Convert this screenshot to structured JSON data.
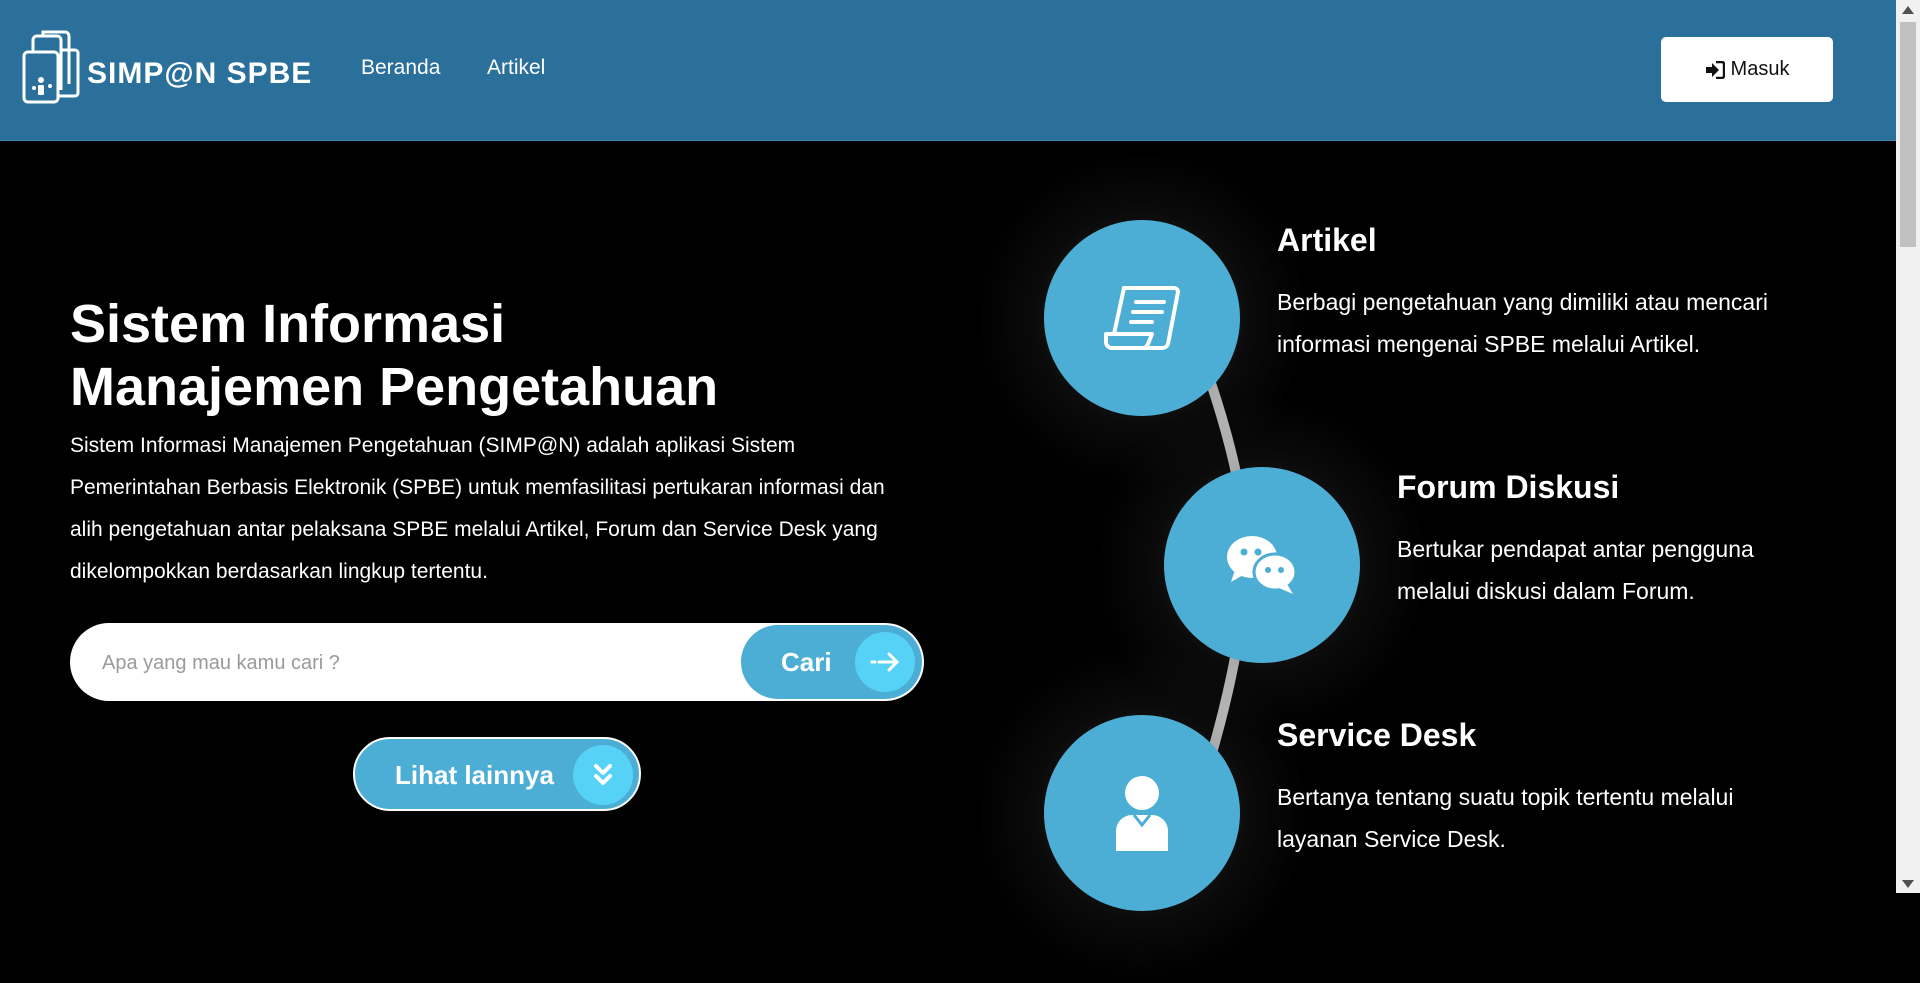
{
  "header": {
    "logo_text": "SIMP@N SPBE",
    "nav": [
      {
        "label": "Beranda"
      },
      {
        "label": "Artikel"
      }
    ],
    "login_label": "Masuk"
  },
  "hero": {
    "title_line1": "Sistem Informasi",
    "title_line2": "Manajemen Pengetahuan",
    "description": "Sistem Informasi Manajemen Pengetahuan (SIMP@N) adalah aplikasi Sistem Pemerintahan Berbasis Elektronik (SPBE) untuk memfasilitasi pertukaran informasi dan alih pengetahuan antar pelaksana SPBE melalui Artikel, Forum dan Service Desk yang dikelompokkan berdasarkan lingkup tertentu.",
    "search_placeholder": "Apa yang mau kamu cari ?",
    "search_button": "Cari",
    "more_button": "Lihat lainnya"
  },
  "features": [
    {
      "title": "Artikel",
      "description": "Berbagi pengetahuan yang dimiliki atau mencari informasi mengenai SPBE melalui Artikel.",
      "icon": "scroll-document-icon"
    },
    {
      "title": "Forum Diskusi",
      "description": "Bertukar pendapat antar pengguna melalui diskusi dalam Forum.",
      "icon": "chat-bubbles-icon"
    },
    {
      "title": "Service Desk",
      "description": "Bertanya tentang suatu topik tertentu melalui layanan Service Desk.",
      "icon": "user-icon"
    }
  ],
  "colors": {
    "navbar": "#2a709b",
    "accent": "#4caed4",
    "accent_light": "#56d2f6",
    "background": "#000000"
  }
}
